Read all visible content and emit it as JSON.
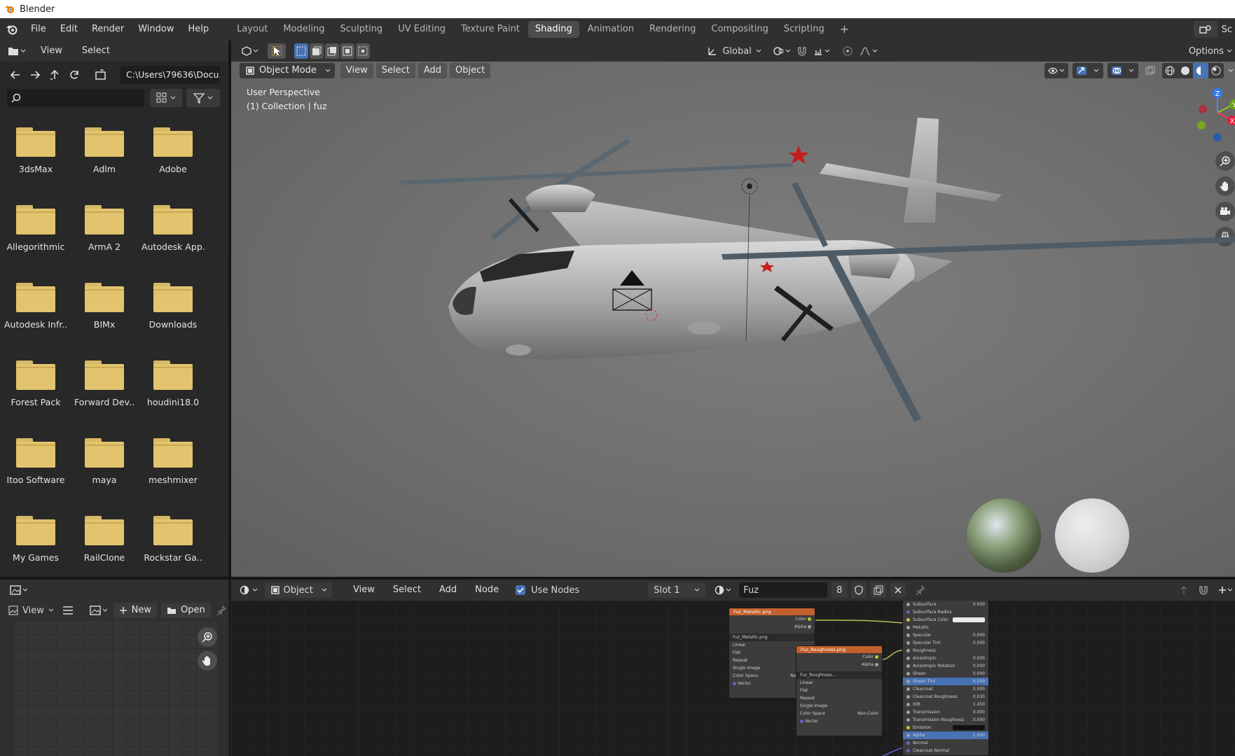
{
  "window": {
    "title": "Blender"
  },
  "menu": [
    "File",
    "Edit",
    "Render",
    "Window",
    "Help"
  ],
  "workspaces": [
    {
      "label": "Layout",
      "active": false
    },
    {
      "label": "Modeling",
      "active": false
    },
    {
      "label": "Sculpting",
      "active": false
    },
    {
      "label": "UV Editing",
      "active": false
    },
    {
      "label": "Texture Paint",
      "active": false
    },
    {
      "label": "Shading",
      "active": true
    },
    {
      "label": "Animation",
      "active": false
    },
    {
      "label": "Rendering",
      "active": false
    },
    {
      "label": "Compositing",
      "active": false
    },
    {
      "label": "Scripting",
      "active": false
    }
  ],
  "add_workspace": "+",
  "scene_label": "Sc",
  "file_browser": {
    "header_menu": [
      "View",
      "Select"
    ],
    "path": "C:\\Users\\79636\\Docu...",
    "search_placeholder": "",
    "folders": [
      "3dsMax",
      "Adlm",
      "Adobe",
      "Allegorithmic",
      "ArmA 2",
      "Autodesk App..",
      "Autodesk Infr..",
      "BIMx",
      "Downloads",
      "Forest Pack",
      "Forward Dev..",
      "houdini18.0",
      "Itoo Software",
      "maya",
      "meshmixer",
      "My Games",
      "RailClone",
      "Rockstar Ga.."
    ]
  },
  "viewport_header": {
    "transform_orientation": "Global",
    "options_label": "Options",
    "mode": "Object Mode",
    "menus": [
      "View",
      "Select",
      "Add",
      "Object"
    ]
  },
  "viewport": {
    "perspective_text": "User Perspective",
    "collection_text": "(1) Collection | fuz",
    "gizmo_axes": [
      "Z",
      "Y",
      "X"
    ]
  },
  "image_editor": {
    "view_label": "View",
    "new_label": "New",
    "open_label": "Open"
  },
  "node_editor": {
    "editor_type": "Object",
    "menus": [
      "View",
      "Select",
      "Add",
      "Node"
    ],
    "use_nodes_label": "Use Nodes",
    "use_nodes_checked": true,
    "slot": "Slot 1",
    "material_name": "Fuz",
    "users_count": "8"
  },
  "nodes": {
    "metallic": {
      "title": "Fuz_Metallic.png",
      "outputs": [
        "Color",
        "Alpha"
      ],
      "image": "Fuz_Metallic.png",
      "rows": [
        "Linear",
        "Flat",
        "Repeat",
        "Single Image",
        "Color Space",
        "Vector"
      ],
      "color_space_value": "Non-Color"
    },
    "roughness": {
      "title": "Fuz_Roughness.png",
      "outputs": [
        "Color",
        "Alpha"
      ],
      "image": "Fuz_Roughness...",
      "rows": [
        "Linear",
        "Flat",
        "Repeat",
        "Single Image",
        "Color Space",
        "Vector"
      ],
      "color_space_value": "Non-Color"
    },
    "bsdf_inputs": [
      {
        "label": "Subsurface",
        "value": "0.000"
      },
      {
        "label": "Subsurface Radius",
        "value": ""
      },
      {
        "label": "Subsurface Color",
        "value": ""
      },
      {
        "label": "Metallic",
        "value": ""
      },
      {
        "label": "Specular",
        "value": "0.000"
      },
      {
        "label": "Specular Tint",
        "value": "0.000"
      },
      {
        "label": "Roughness",
        "value": ""
      },
      {
        "label": "Anisotropic",
        "value": "0.000"
      },
      {
        "label": "Anisotropic Rotation",
        "value": "0.000"
      },
      {
        "label": "Sheen",
        "value": "0.000"
      },
      {
        "label": "Sheen Tint",
        "value": "0.500"
      },
      {
        "label": "Clearcoat",
        "value": "0.000"
      },
      {
        "label": "Clearcoat Roughness",
        "value": "0.030"
      },
      {
        "label": "IOR",
        "value": "1.450"
      },
      {
        "label": "Transmission",
        "value": "0.000"
      },
      {
        "label": "Transmission Roughness",
        "value": "0.000"
      },
      {
        "label": "Emission",
        "value": ""
      },
      {
        "label": "Alpha",
        "value": "1.000"
      },
      {
        "label": "Normal",
        "value": ""
      },
      {
        "label": "Clearcoat Normal",
        "value": ""
      }
    ]
  },
  "colors": {
    "accent": "#4772b3",
    "node_header": "#c2612d",
    "folder": "#e3c46e"
  }
}
